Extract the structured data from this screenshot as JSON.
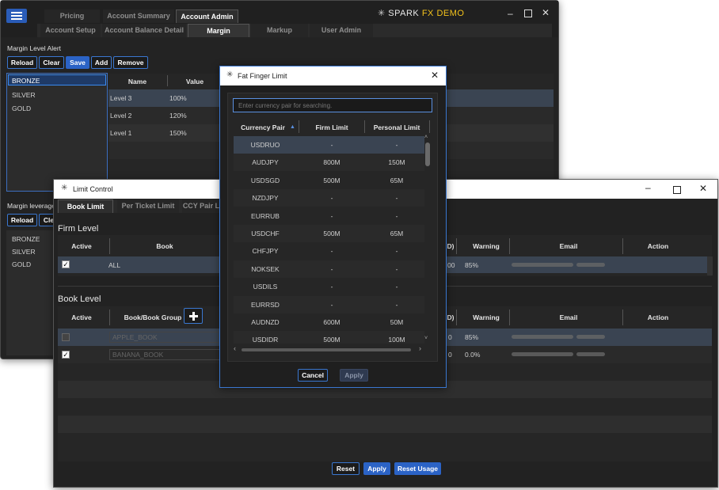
{
  "main": {
    "brand": {
      "prefix": "SPARK",
      "accent": "FX DEMO",
      "accent_color": "#f3c21b"
    },
    "top_tabs": [
      "Pricing",
      "Account Summary",
      "Account Admin"
    ],
    "sub_tabs": [
      "Account Setup",
      "Account Balance Detail",
      "Margin",
      "Markup",
      "User Admin"
    ],
    "margin_alert_title": "Margin Level Alert",
    "toolbar": [
      "Reload",
      "Clear",
      "Save",
      "Add",
      "Remove"
    ],
    "tiers": [
      "BRONZE",
      "SILVER",
      "GOLD"
    ],
    "level_headers": [
      "Name",
      "Value"
    ],
    "levels": [
      {
        "name": "Level 3",
        "value": "100%"
      },
      {
        "name": "Level 2",
        "value": "120%"
      },
      {
        "name": "Level 1",
        "value": "150%"
      }
    ],
    "margin_leverage_title": "Margin leverage",
    "toolbar2": [
      "Reload",
      "Cle"
    ],
    "tiers2": [
      "BRONZE",
      "SILVER",
      "GOLD"
    ]
  },
  "limit": {
    "title": "Limit Control",
    "tabs": [
      "Book Limit",
      "Per Ticket Limit",
      "CCY Pair L"
    ],
    "firm_level": "Firm Level",
    "firm_headers": [
      "Active",
      "Book",
      "D)",
      "Warning",
      "Email",
      "Action"
    ],
    "firm_row": {
      "book": "ALL",
      "col_d": "00",
      "warning": "85%"
    },
    "book_level": "Book Level",
    "book_headers": [
      "Active",
      "Book/Book Group",
      "D)",
      "Warning",
      "Email",
      "Action"
    ],
    "book_rows": [
      {
        "book": "APPLE_BOOK",
        "col_d": "0",
        "warning": "85%"
      },
      {
        "book": "BANANA_BOOK",
        "col_d": "0",
        "warning": "0.0%"
      }
    ],
    "buttons": [
      "Reset",
      "Apply",
      "Reset Usage"
    ]
  },
  "fat": {
    "title": "Fat Finger Limit",
    "search_placeholder": "Enter currency pair for searching.",
    "headers": [
      "Currency Pair",
      "Firm Limit",
      "Personal Limit"
    ],
    "rows": [
      {
        "pair": "USDRUO",
        "firm": "-",
        "personal": "-"
      },
      {
        "pair": "AUDJPY",
        "firm": "800M",
        "personal": "150M"
      },
      {
        "pair": "USDSGD",
        "firm": "500M",
        "personal": "65M"
      },
      {
        "pair": "NZDJPY",
        "firm": "-",
        "personal": "-"
      },
      {
        "pair": "EURRUB",
        "firm": "-",
        "personal": "-"
      },
      {
        "pair": "USDCHF",
        "firm": "500M",
        "personal": "65M"
      },
      {
        "pair": "CHFJPY",
        "firm": "-",
        "personal": "-"
      },
      {
        "pair": "NOKSEK",
        "firm": "-",
        "personal": "-"
      },
      {
        "pair": "USDILS",
        "firm": "-",
        "personal": "-"
      },
      {
        "pair": "EURRSD",
        "firm": "-",
        "personal": "-"
      },
      {
        "pair": "AUDNZD",
        "firm": "600M",
        "personal": "50M"
      },
      {
        "pair": "USDIDR",
        "firm": "500M",
        "personal": "100M"
      }
    ],
    "buttons": [
      "Cancel",
      "Apply"
    ]
  }
}
